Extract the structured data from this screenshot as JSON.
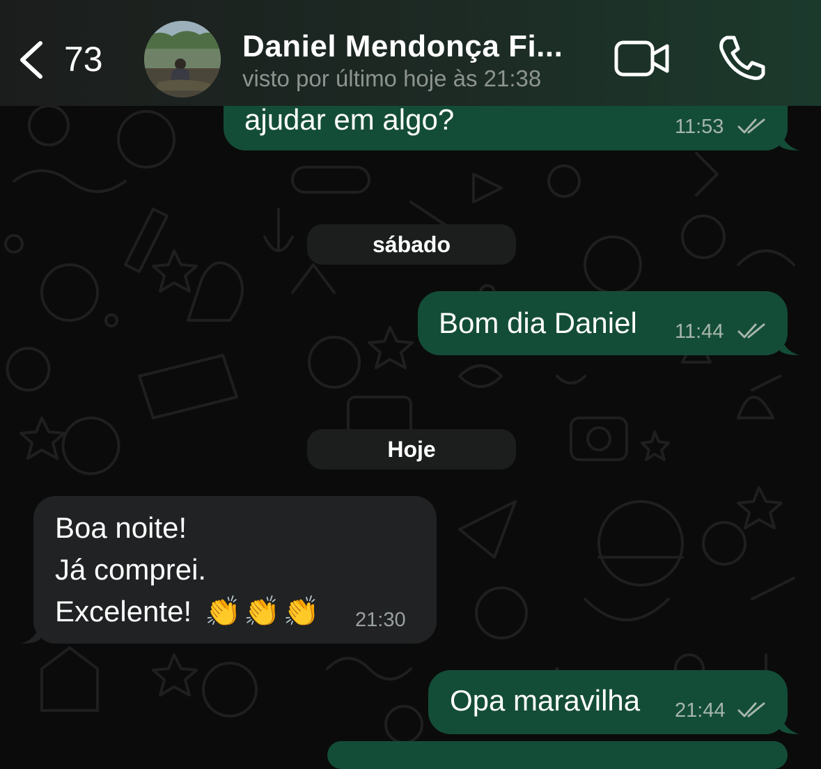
{
  "header": {
    "back_count": "73",
    "contact_name": "Daniel Mendonça Fi...",
    "contact_status": "visto por último hoje às 21:38"
  },
  "messages": [
    {
      "direction": "out",
      "text": "ajudar em algo?",
      "time": "11:53",
      "read": true
    },
    {
      "direction": "out",
      "text": "Bom dia Daniel",
      "time": "11:44",
      "read": true
    },
    {
      "direction": "in",
      "lines": [
        "Boa noite!",
        "Já comprei.",
        "Excelente!"
      ],
      "emoji": "👏👏👏",
      "time": "21:30"
    },
    {
      "direction": "out",
      "text": "Opa maravilha",
      "time": "21:44",
      "read": true
    }
  ],
  "day_separators": [
    "sábado",
    "Hoje"
  ],
  "colors": {
    "outgoing_bubble": "#144d37",
    "incoming_bubble": "#202223",
    "chat_background": "#0b0b0b",
    "read_ticks": "#a6b6ad"
  }
}
